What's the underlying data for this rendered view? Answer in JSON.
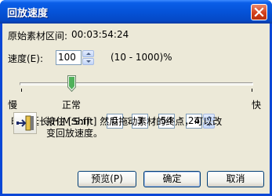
{
  "window": {
    "title": "回放速度"
  },
  "original_range": {
    "label": "原始素材区间:",
    "value": "00:03:54:24"
  },
  "speed": {
    "label": "速度(E):",
    "value": "100",
    "range_text": "(10 - 1000)%"
  },
  "slider": {
    "level_percent": 100,
    "min_label": "慢",
    "mid_label": "正常",
    "max_label": "快"
  },
  "duration": {
    "label": "时间延长(H:M:S:f):",
    "hours": "0",
    "minutes": "3",
    "seconds": "54",
    "frames": "24",
    "separator": ":"
  },
  "hint": {
    "line1": "按住 [Shift] 然后拖动素材的终点，可以改",
    "line2": "变回放速度。"
  },
  "buttons": {
    "preview": "预览(P)",
    "ok": "确定",
    "cancel": "取消"
  },
  "colors": {
    "title_bar": "#0553d8",
    "client_bg": "#ece9d8",
    "close_button": "#d4401c"
  }
}
